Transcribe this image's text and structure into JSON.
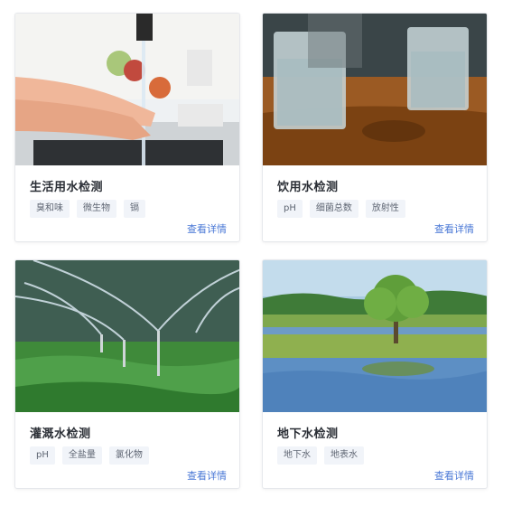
{
  "cards": [
    {
      "title": "生活用水检测",
      "tags": [
        "臭和味",
        "微生物",
        "镉"
      ],
      "link": "查看详情"
    },
    {
      "title": "饮用水检测",
      "tags": [
        "pH",
        "细菌总数",
        "放射性"
      ],
      "link": "查看详情"
    },
    {
      "title": "灌溉水检测",
      "tags": [
        "pH",
        "全盐量",
        "氯化物"
      ],
      "link": "查看详情"
    },
    {
      "title": "地下水检测",
      "tags": [
        "地下水",
        "地表水"
      ],
      "link": "查看详情"
    }
  ],
  "colors": {
    "link": "#4a78d6",
    "tag_bg": "#f1f4f9",
    "title": "#2b2f36"
  }
}
